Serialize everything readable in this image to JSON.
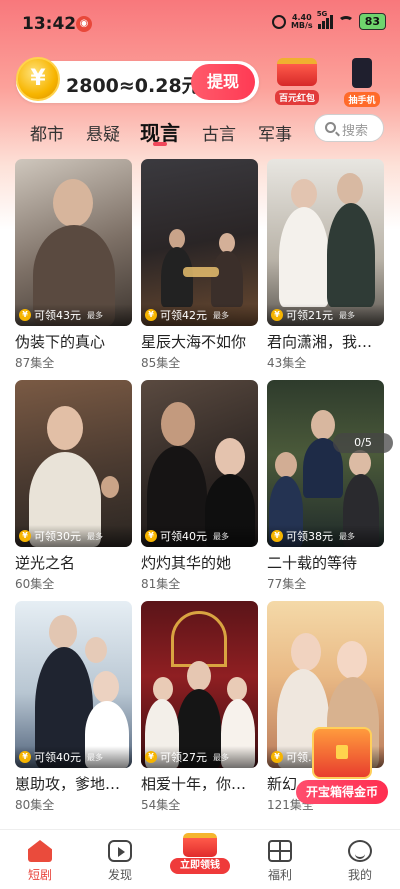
{
  "status": {
    "time": "13:42",
    "net_speed": "4.40",
    "net_unit": "MB/s",
    "sig_label": "5G",
    "battery": "83"
  },
  "wallet": {
    "coin_symbol": "¥",
    "amount": "2800≈0.28元",
    "cash_button": "提现"
  },
  "promos": [
    {
      "label": "百元红包",
      "icon": "red-packet-icon"
    },
    {
      "label": "抽手机",
      "icon": "phone-icon"
    }
  ],
  "tabs": [
    {
      "label": "都市"
    },
    {
      "label": "悬疑"
    },
    {
      "label": "现言",
      "active": true
    },
    {
      "label": "古言"
    },
    {
      "label": "军事"
    }
  ],
  "search": {
    "placeholder": "搜索"
  },
  "dramas": [
    {
      "title": "伪装下的真心",
      "episodes": "87集全",
      "reward": "可领43元",
      "more": "最多"
    },
    {
      "title": "星辰大海不如你",
      "episodes": "85集全",
      "reward": "可领42元",
      "more": "最多"
    },
    {
      "title": "君向潇湘，我…",
      "episodes": "43集全",
      "reward": "可领21元",
      "more": "最多"
    },
    {
      "title": "逆光之名",
      "episodes": "60集全",
      "reward": "可领30元",
      "more": "最多"
    },
    {
      "title": "灼灼其华的她",
      "episodes": "81集全",
      "reward": "可领40元",
      "more": "最多"
    },
    {
      "title": "二十载的等待",
      "episodes": "77集全",
      "reward": "可领38元",
      "more": "最多"
    },
    {
      "title": "崽助攻，爹地…",
      "episodes": "80集全",
      "reward": "可领40元",
      "more": "最多"
    },
    {
      "title": "相爱十年，你…",
      "episodes": "54集全",
      "reward": "可领27元",
      "more": "最多"
    },
    {
      "title": "新幻…",
      "episodes": "121集全",
      "reward": "可领…",
      "more": "最多"
    }
  ],
  "carousel_counter": "0/5",
  "treasure_button": "开宝箱得金币",
  "nav": [
    {
      "label": "短剧",
      "active": true
    },
    {
      "label": "发现"
    },
    {
      "label": "立即领钱"
    },
    {
      "label": "福利"
    },
    {
      "label": "我的"
    }
  ],
  "colors": {
    "accent": "#f0485b",
    "coin": "#f7b500",
    "nav_active": "#e8453c"
  }
}
